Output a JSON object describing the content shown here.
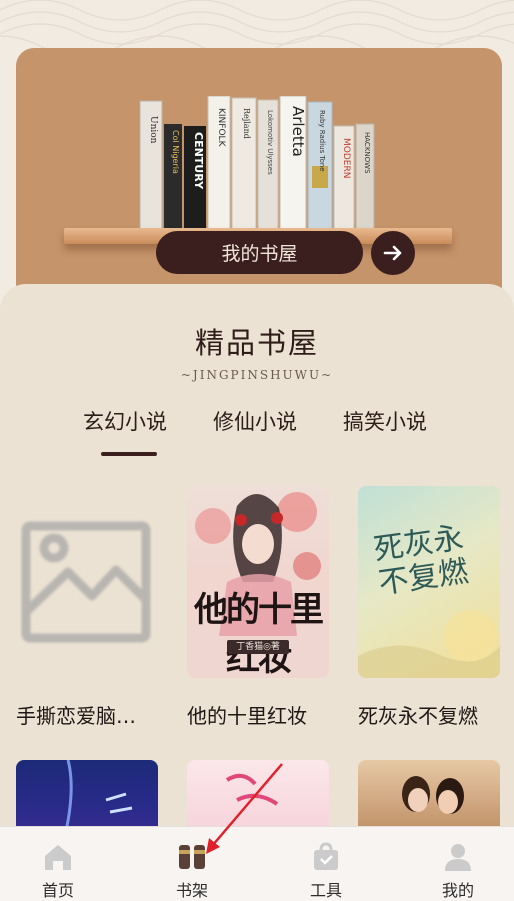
{
  "hero": {
    "button_label": "我的书屋",
    "book_spines": [
      "Union",
      "Col Nigeria",
      "CENTURY",
      "KINFOLK",
      "Rejland",
      "Lokomotiv Ulysses",
      "Arletta",
      "Ruby Radius Tone",
      "MODERN",
      "HACKNOWS"
    ]
  },
  "section": {
    "title": "精品书屋",
    "subtitle": "~JINGPINSHUWU~"
  },
  "tabs": [
    {
      "label": "玄幻小说",
      "active": true
    },
    {
      "label": "修仙小说",
      "active": false
    },
    {
      "label": "搞笑小说",
      "active": false
    }
  ],
  "books": [
    {
      "title": "手撕恋爱脑…",
      "cover": "placeholder-image-icon"
    },
    {
      "title": "他的十里红妆",
      "cover_text": "他的十里红妆",
      "cover_author": "丁香猫◎著"
    },
    {
      "title": "死灰永不复燃",
      "cover_text": "死灰永不复燃"
    }
  ],
  "bottom_nav": [
    {
      "label": "首页",
      "icon": "home-icon",
      "active": false
    },
    {
      "label": "书架",
      "icon": "bookshelf-icon",
      "active": true
    },
    {
      "label": "工具",
      "icon": "toolbag-icon",
      "active": false
    },
    {
      "label": "我的",
      "icon": "user-icon",
      "active": false
    }
  ],
  "colors": {
    "brand_dark": "#3b1f1e",
    "hero_bg": "#c6946a",
    "panel_bg": "#ece2d3",
    "annotation_arrow": "#e0202a"
  }
}
